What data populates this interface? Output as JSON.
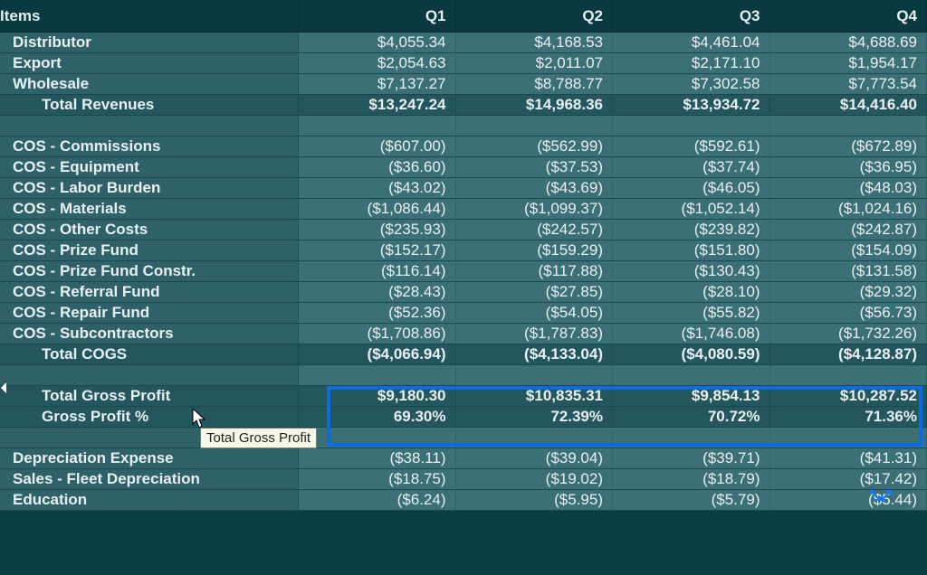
{
  "columns": {
    "items": "Items",
    "q1": "Q1",
    "q2": "Q2",
    "q3": "Q3",
    "q4": "Q4"
  },
  "revenues": {
    "rows": [
      {
        "label": "Distributor",
        "q1": "$4,055.34",
        "q2": "$4,168.53",
        "q3": "$4,461.04",
        "q4": "$4,688.69"
      },
      {
        "label": "Export",
        "q1": "$2,054.63",
        "q2": "$2,011.07",
        "q3": "$2,171.10",
        "q4": "$1,954.17"
      },
      {
        "label": "Wholesale",
        "q1": "$7,137.27",
        "q2": "$8,788.77",
        "q3": "$7,302.58",
        "q4": "$7,773.54"
      }
    ],
    "total": {
      "label": "Total Revenues",
      "q1": "$13,247.24",
      "q2": "$14,968.36",
      "q3": "$13,934.72",
      "q4": "$14,416.40"
    }
  },
  "cogs": {
    "rows": [
      {
        "label": "COS - Commissions",
        "q1": "($607.00)",
        "q2": "($562.99)",
        "q3": "($592.61)",
        "q4": "($672.89)"
      },
      {
        "label": "COS - Equipment",
        "q1": "($36.60)",
        "q2": "($37.53)",
        "q3": "($37.74)",
        "q4": "($36.95)"
      },
      {
        "label": "COS - Labor Burden",
        "q1": "($43.02)",
        "q2": "($43.69)",
        "q3": "($46.05)",
        "q4": "($48.03)"
      },
      {
        "label": "COS - Materials",
        "q1": "($1,086.44)",
        "q2": "($1,099.37)",
        "q3": "($1,052.14)",
        "q4": "($1,024.16)"
      },
      {
        "label": "COS - Other Costs",
        "q1": "($235.93)",
        "q2": "($242.57)",
        "q3": "($239.82)",
        "q4": "($242.87)"
      },
      {
        "label": "COS - Prize Fund",
        "q1": "($152.17)",
        "q2": "($159.29)",
        "q3": "($151.80)",
        "q4": "($154.09)"
      },
      {
        "label": "COS - Prize Fund Constr.",
        "q1": "($116.14)",
        "q2": "($117.88)",
        "q3": "($130.43)",
        "q4": "($131.58)"
      },
      {
        "label": "COS - Referral Fund",
        "q1": "($28.43)",
        "q2": "($27.85)",
        "q3": "($28.10)",
        "q4": "($29.32)"
      },
      {
        "label": "COS - Repair Fund",
        "q1": "($52.36)",
        "q2": "($54.05)",
        "q3": "($55.82)",
        "q4": "($56.73)"
      },
      {
        "label": "COS - Subcontractors",
        "q1": "($1,708.86)",
        "q2": "($1,787.83)",
        "q3": "($1,746.08)",
        "q4": "($1,732.26)"
      }
    ],
    "total": {
      "label": "Total COGS",
      "q1": "($4,066.94)",
      "q2": "($4,133.04)",
      "q3": "($4,080.59)",
      "q4": "($4,128.87)"
    }
  },
  "gross": {
    "profit": {
      "label": "Total Gross Profit",
      "q1": "$9,180.30",
      "q2": "$10,835.31",
      "q3": "$9,854.13",
      "q4": "$10,287.52"
    },
    "percent": {
      "label": "Gross Profit %",
      "q1": "69.30%",
      "q2": "72.39%",
      "q3": "70.72%",
      "q4": "71.36%"
    }
  },
  "expenses": {
    "rows": [
      {
        "label": "Depreciation Expense",
        "q1": "($38.11)",
        "q2": "($39.04)",
        "q3": "($39.71)",
        "q4": "($41.31)"
      },
      {
        "label": "Sales - Fleet Depreciation",
        "q1": "($18.75)",
        "q2": "($19.02)",
        "q3": "($18.79)",
        "q4": "($17.42)"
      },
      {
        "label": "Education",
        "q1": "($6.24)",
        "q2": "($5.95)",
        "q3": "($5.79)",
        "q4": "($5.44)"
      }
    ]
  },
  "tooltip": "Total Gross Profit"
}
